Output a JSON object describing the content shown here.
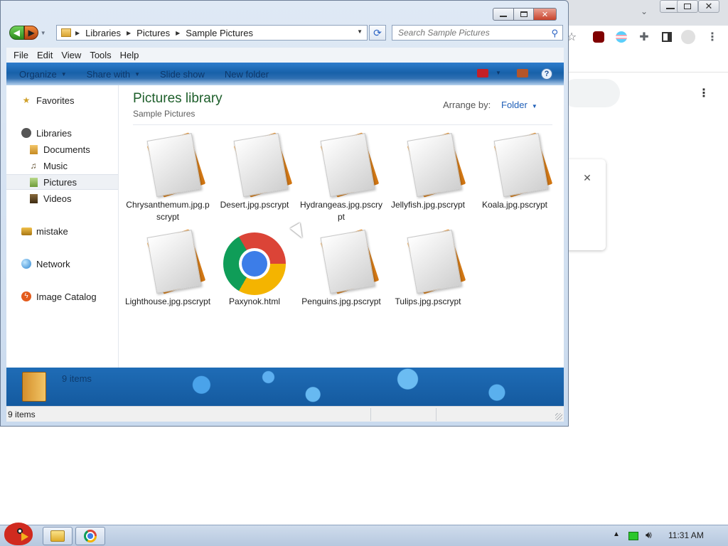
{
  "explorer": {
    "address": {
      "crumbs": [
        "Libraries",
        "Pictures",
        "Sample Pictures"
      ]
    },
    "search": {
      "placeholder": "Search Sample Pictures"
    },
    "menu": [
      "File",
      "Edit",
      "View",
      "Tools",
      "Help"
    ],
    "commands": {
      "organize": "Organize",
      "share_with": "Share with",
      "slide_show": "Slide show",
      "new_folder": "New folder"
    },
    "nav": {
      "favorites": "Favorites",
      "libraries": "Libraries",
      "documents": "Documents",
      "music": "Music",
      "pictures": "Pictures",
      "videos": "Videos",
      "user": "mistake",
      "network": "Network",
      "image_catalog": "Image Catalog"
    },
    "content": {
      "title": "Pictures library",
      "subtitle": "Sample Pictures",
      "arrange_label": "Arrange by:",
      "arrange_value": "Folder"
    },
    "files": [
      "Chrysanthemum.jpg.pscrypt",
      "Desert.jpg.pscrypt",
      "Hydrangeas.jpg.pscrypt",
      "Jellyfish.jpg.pscrypt",
      "Koala.jpg.pscrypt",
      "Lighthouse.jpg.pscrypt",
      "Paxynok.html",
      "Penguins.jpg.pscrypt",
      "Tulips.jpg.pscrypt"
    ],
    "details_text": "9 items",
    "status_text": "9 items"
  },
  "taskbar": {
    "clock": "11:31 AM"
  },
  "colors": {
    "accent": "#1f5fb8",
    "title_green": "#1d5e2a",
    "command_bar": "#1761a9",
    "close": "#c8432c"
  },
  "icons": {
    "back": "back-arrow-icon",
    "forward": "forward-arrow-icon",
    "refresh": "refresh-icon",
    "search": "magnifier-icon",
    "favorites": "star-icon",
    "libraries": "library-icon",
    "network": "network-globe-icon",
    "image_catalog": "catalog-icon",
    "file": "encrypted-file-icon",
    "html": "chrome-icon",
    "start": "angry-bird-start-icon"
  }
}
